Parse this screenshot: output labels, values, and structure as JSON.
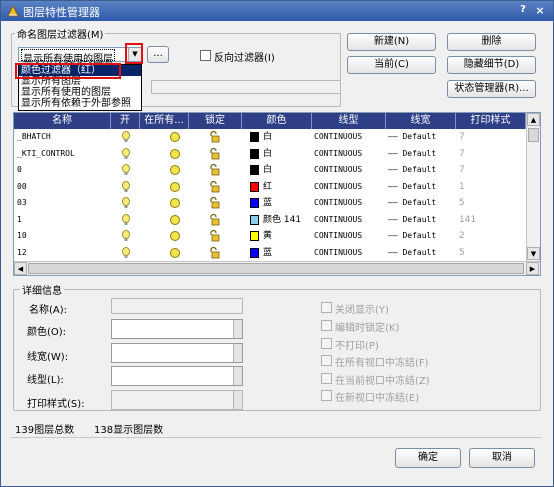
{
  "window": {
    "title": "图层特性管理器",
    "help": "?",
    "close": "×"
  },
  "filter_group": {
    "label": "命名图层过滤器(M)",
    "combo_value": "显示所有使用的图层",
    "browse_label": "...",
    "invert_label": "反向过滤器(I)",
    "dropdown_items": [
      "颜色过滤器（红）",
      "显示所有图层",
      "显示所有使用的图层",
      "显示所有依赖于外部参照"
    ],
    "second_line_prefix": "显"
  },
  "buttons": {
    "new": "新建(N)",
    "delete": "删除",
    "current": "当前(C)",
    "hide_details": "隐藏细节(D)",
    "state_manager": "状态管理器(R)...",
    "ok": "确定",
    "cancel": "取消"
  },
  "table": {
    "headers": [
      "名称",
      "开",
      "在所有...",
      "锁定",
      "颜色",
      "线型",
      "线宽",
      "打印样式"
    ],
    "rows": [
      {
        "name": "_BHATCH",
        "color_hex": "#000000",
        "color_name": "白",
        "linetype": "CONTINUOUS",
        "lineweight": "—— Default",
        "plot": "7"
      },
      {
        "name": "_KTI_CONTROL",
        "color_hex": "#000000",
        "color_name": "白",
        "linetype": "CONTINUOUS",
        "lineweight": "—— Default",
        "plot": "7"
      },
      {
        "name": "0",
        "color_hex": "#000000",
        "color_name": "白",
        "linetype": "CONTINUOUS",
        "lineweight": "—— Default",
        "plot": "7"
      },
      {
        "name": "00",
        "color_hex": "#ff0000",
        "color_name": "红",
        "linetype": "CONTINUOUS",
        "lineweight": "—— Default",
        "plot": "1"
      },
      {
        "name": "03",
        "color_hex": "#0000ff",
        "color_name": "蓝",
        "linetype": "CONTINUOUS",
        "lineweight": "—— Default",
        "plot": "5"
      },
      {
        "name": "1",
        "color_hex": "#88ccee",
        "color_name": "颜色 141",
        "linetype": "CONTINUOUS",
        "lineweight": "—— Default",
        "plot": "141"
      },
      {
        "name": "10",
        "color_hex": "#ffff00",
        "color_name": "黄",
        "linetype": "CONTINUOUS",
        "lineweight": "—— Default",
        "plot": "2"
      },
      {
        "name": "12",
        "color_hex": "#0000ff",
        "color_name": "蓝",
        "linetype": "CONTINUOUS",
        "lineweight": "—— Default",
        "plot": "5"
      }
    ]
  },
  "details": {
    "group_label": "详细信息",
    "name_label": "名称(A):",
    "color_label": "颜色(O):",
    "lineweight_label": "线宽(W):",
    "linetype_label": "线型(L):",
    "plot_label": "打印样式(S):",
    "checks": [
      "关闭显示(Y)",
      "编辑时锁定(K)",
      "不打印(P)",
      "在所有视口中冻结(F)",
      "在当前视口中冻结(Z)",
      "在新视口中冻结(E)"
    ]
  },
  "status": {
    "total": "139图层总数",
    "shown": "138显示图层数"
  }
}
